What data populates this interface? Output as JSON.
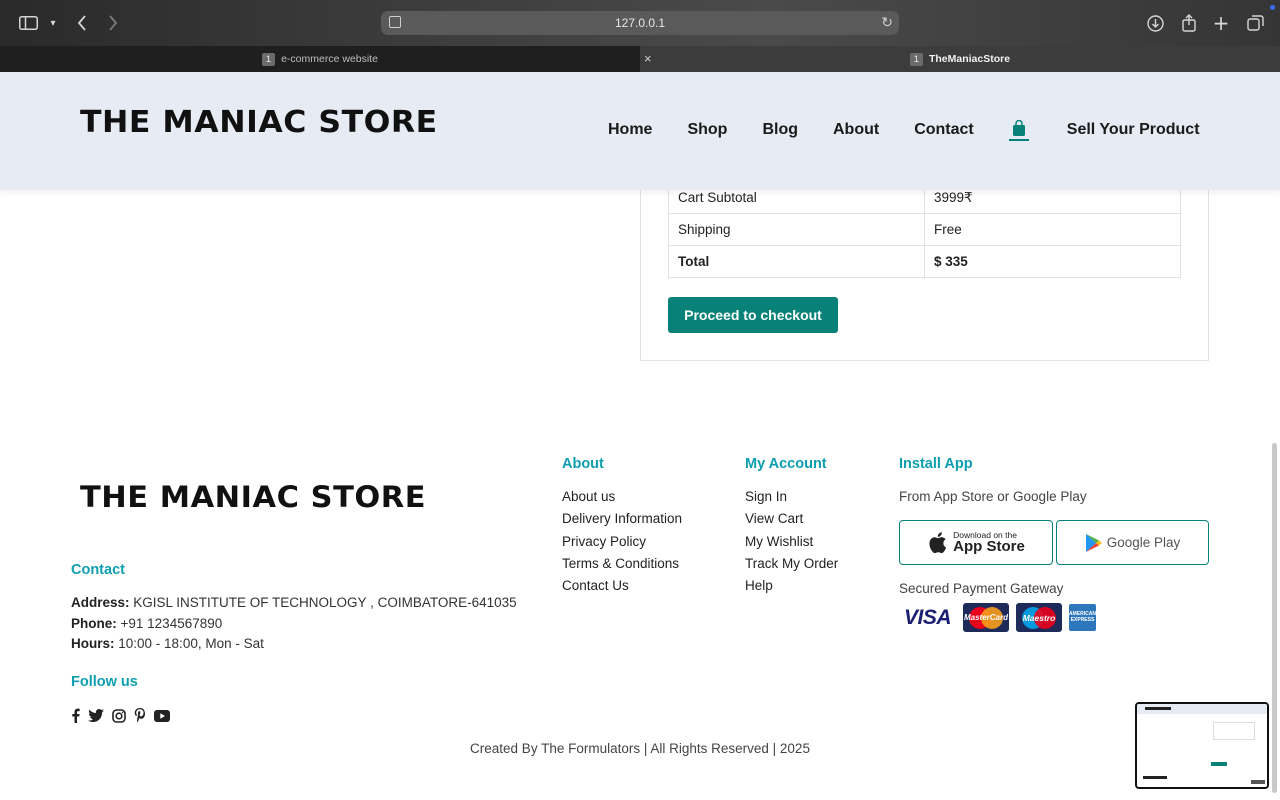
{
  "browser": {
    "url": "127.0.0.1",
    "tabs": [
      {
        "number": "1",
        "title": "e-commerce website"
      },
      {
        "number": "1",
        "title": "TheManiacStore"
      }
    ],
    "tab_close_glyph": "×"
  },
  "header": {
    "logo_text": "THE MANIAC STORE",
    "nav": [
      "Home",
      "Shop",
      "Blog",
      "About",
      "Contact",
      "Sell Your Product"
    ],
    "accent_color": "#088178",
    "background_color": "#e6ebf4"
  },
  "cart_totals": {
    "rows": [
      {
        "label": "Cart Subtotal",
        "value": "3999₹"
      },
      {
        "label": "Shipping",
        "value": "Free"
      },
      {
        "label": "Total",
        "value": "$ 335"
      }
    ],
    "checkout_label": "Proceed to checkout"
  },
  "footer": {
    "logo_text": "THE MANIAC STORE",
    "contact_heading": "Contact",
    "address_label": "Address:",
    "address_value": "KGISL INSTITUTE OF TECHNOLOGY , COIMBATORE-641035",
    "phone_label": "Phone:",
    "phone_value": "+91 1234567890",
    "hours_label": "Hours:",
    "hours_value": "10:00 - 18:00, Mon - Sat",
    "follow_heading": "Follow us",
    "social_icons": [
      "facebook-icon",
      "twitter-icon",
      "instagram-icon",
      "pinterest-icon",
      "youtube-icon"
    ],
    "about_heading": "About",
    "about_links": [
      "About us",
      "Delivery Information",
      "Privacy Policy",
      "Terms & Conditions",
      "Contact Us"
    ],
    "account_heading": "My Account",
    "account_links": [
      "Sign In",
      "View Cart",
      "My Wishlist",
      "Track My Order",
      "Help"
    ],
    "install_heading": "Install App",
    "install_text": "From App Store or Google Play",
    "app_store_small": "Download on the",
    "app_store_big": "App Store",
    "google_play": "Google Play",
    "payment_heading": "Secured Payment Gateway",
    "payment_methods": [
      "VISA",
      "MasterCard",
      "Maestro",
      "AMERICAN EXPRESS"
    ],
    "heading_color": "#0d9eb0",
    "copyright": "Created By The Formulators | All Rights Reserved | 2025"
  }
}
